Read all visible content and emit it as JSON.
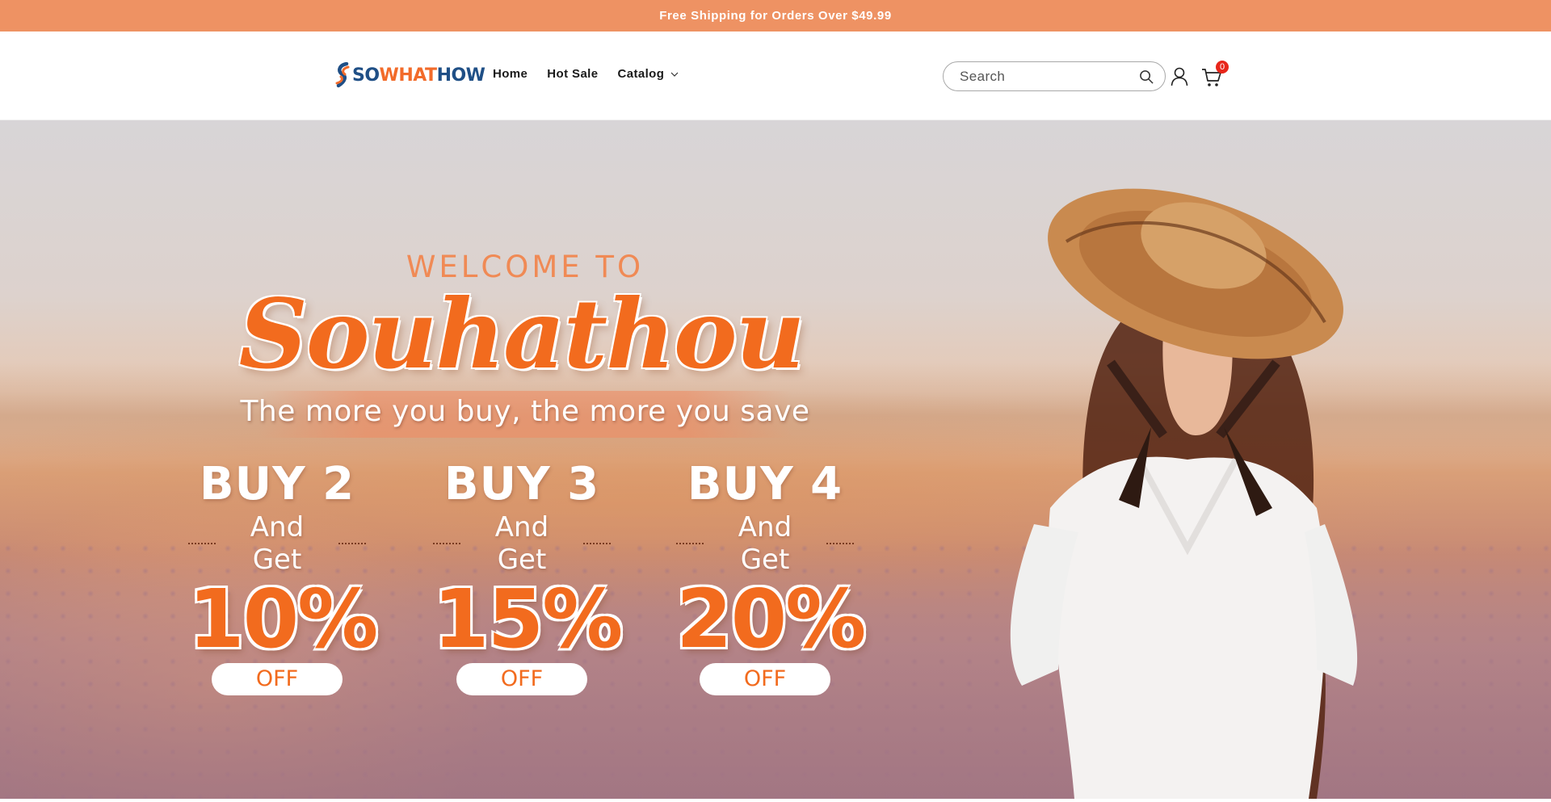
{
  "announcement": {
    "text": "Free Shipping for Orders Over $49.99"
  },
  "header": {
    "logo": {
      "part1": "SO",
      "part2": "WHAT",
      "part3": "HOW"
    },
    "nav": [
      {
        "label": "Home"
      },
      {
        "label": "Hot Sale"
      },
      {
        "label": "Catalog"
      }
    ],
    "search": {
      "placeholder": "Search",
      "icon": "search-icon"
    },
    "account_icon": "account-icon",
    "cart": {
      "icon": "cart-icon",
      "count": "0"
    }
  },
  "hero": {
    "welcome": "WELCOME TO",
    "brand": "Souhathou",
    "tagline": "The more you buy, the more you save",
    "offers": [
      {
        "buy": "BUY 2",
        "get": "And Get",
        "percent": "10%",
        "off": "OFF"
      },
      {
        "buy": "BUY 3",
        "get": "And Get",
        "percent": "15%",
        "off": "OFF"
      },
      {
        "buy": "BUY 4",
        "get": "And Get",
        "percent": "20%",
        "off": "OFF"
      }
    ]
  },
  "colors": {
    "announcement_bg": "#ee9263",
    "brand_orange": "#f26b1e",
    "logo_blue": "#1f4f86",
    "cart_badge": "#e8261a"
  }
}
